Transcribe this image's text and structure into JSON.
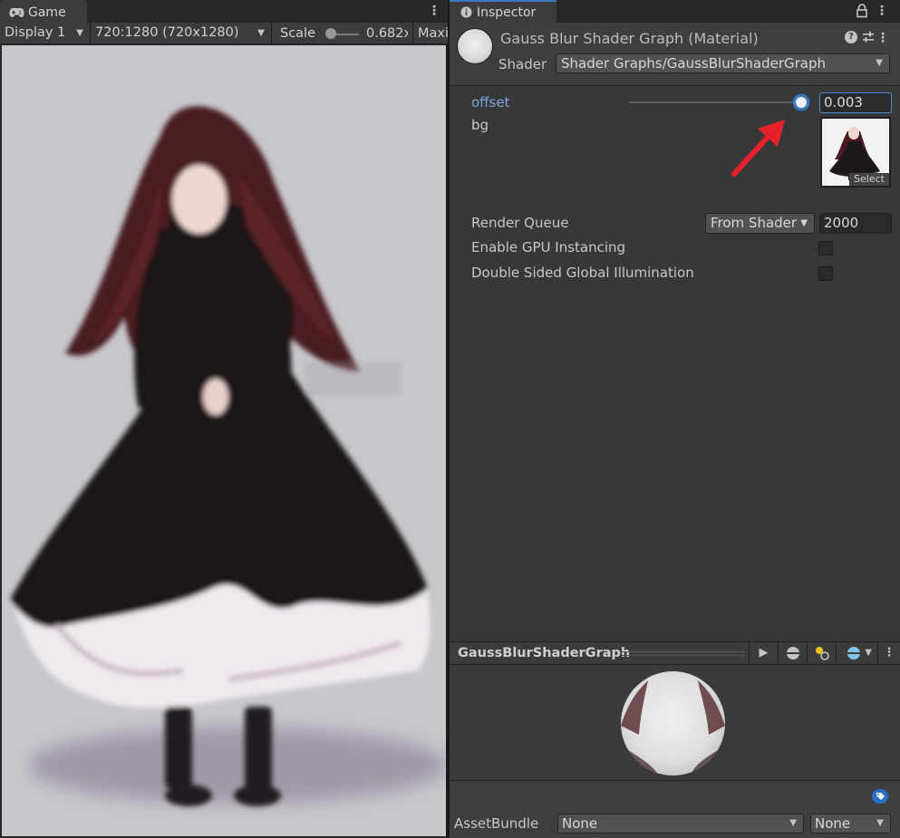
{
  "game": {
    "tab_label": "Game",
    "display": "Display 1",
    "resolution": "720:1280 (720x1280)",
    "scale_label": "Scale",
    "scale_value": "0.682x",
    "max_label": "Maximize On Play"
  },
  "inspector": {
    "tab_label": "Inspector",
    "material_title": "Gauss Blur Shader Graph (Material)",
    "shader_label": "Shader",
    "shader_value": "Shader Graphs/GaussBlurShaderGraph",
    "offset_label": "offset",
    "offset_value": "0.003",
    "offset_slider_fraction": 1.0,
    "bg_label": "bg",
    "bg_select": "Select",
    "render_queue_label": "Render Queue",
    "render_queue_mode": "From Shader",
    "render_queue_value": "2000",
    "gpu_instancing_label": "Enable GPU Instancing",
    "dsgi_label": "Double Sided Global Illumination",
    "preview_title": "GaussBlurShaderGraph",
    "asset_bundle_label": "AssetBundle",
    "asset_bundle_name": "None",
    "asset_bundle_variant": "None"
  },
  "colors": {
    "accent_blue": "#3a79bb",
    "highlight_label": "#7ba7e0",
    "annotation_arrow": "#e8202a"
  }
}
